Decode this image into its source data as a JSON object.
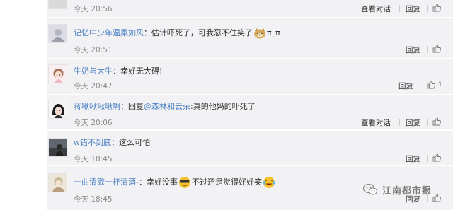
{
  "comments": [
    {
      "name": "",
      "text": "",
      "time": "今天 20:56",
      "view_label": "查看对话",
      "reply_label": "回复",
      "likes": ""
    },
    {
      "name": "记忆中少年温柔如风",
      "text": "：估计吓死了，可我忍不住笑了",
      "suffix": "π_π",
      "time": "今天 20:51",
      "reply_label": "回复",
      "likes": ""
    },
    {
      "name": "牛奶与大牛",
      "text": "：幸好无大碍!",
      "time": "今天 20:47",
      "reply_label": "回复",
      "likes": "1"
    },
    {
      "name": "蒋啾啾啾啾啊",
      "prefix": "：回复",
      "mention": "@森林和云朵",
      "text": ":真的他妈的吓死了",
      "time": "今天 20:06",
      "view_label": "查看对话",
      "reply_label": "回复",
      "likes": ""
    },
    {
      "name": "w错不到底",
      "text": "：这么可怕",
      "time": "今天 18:45",
      "reply_label": "回复",
      "likes": ""
    },
    {
      "name": "一曲清歌一杯清酒-",
      "text": "：幸好没事",
      "text2": "不过还是觉得好好笑",
      "time": "今天 18:45",
      "reply_label": "回复",
      "likes": ""
    }
  ],
  "watermark": {
    "text": "江南都市报",
    "icon": "wechat-icon"
  },
  "colors": {
    "link": "#4a7fc1",
    "row_bg": "#f2f2f5",
    "meta": "#8a8a8a"
  }
}
